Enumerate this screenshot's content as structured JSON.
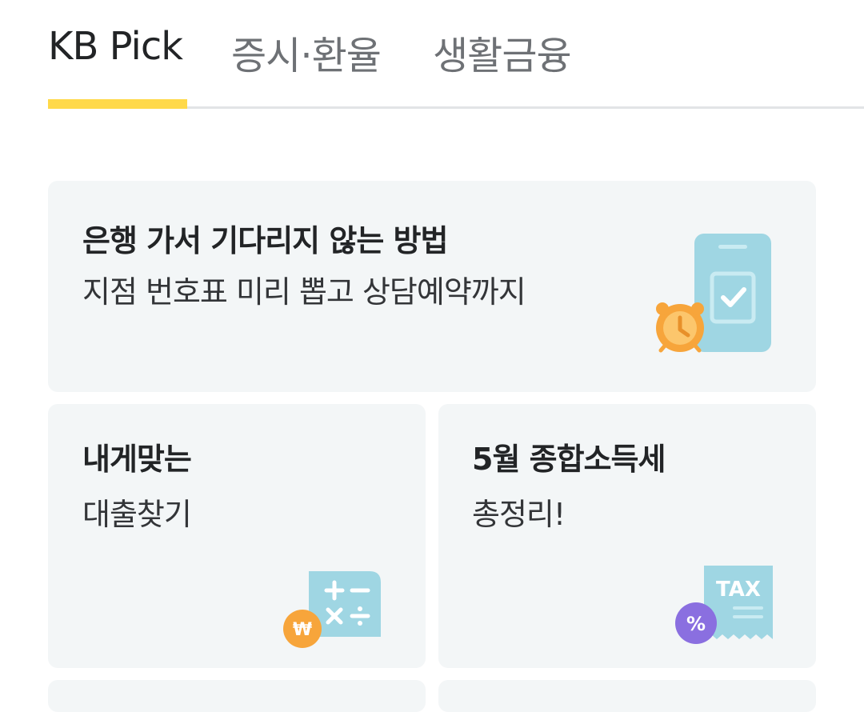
{
  "tabs": [
    {
      "label": "KB Pick",
      "active": true
    },
    {
      "label": "증시·환율",
      "active": false
    },
    {
      "label": "생활금융",
      "active": false
    }
  ],
  "cards": {
    "hero": {
      "title": "은행 가서 기다리지 않는 방법",
      "subtitle": "지점 번호표 미리 뽑고 상담예약까지",
      "icon": "phone-alarm-clock-icon"
    },
    "loan": {
      "title": "내게맞는",
      "subtitle": "대출찾기",
      "icon": "calculator-won-icon"
    },
    "tax": {
      "title": "5월 종합소득세",
      "subtitle": "총정리!",
      "icon": "tax-receipt-percent-icon",
      "icon_text": "TAX",
      "badge_text": "%"
    }
  },
  "colors": {
    "accent": "#ffd94a",
    "card_bg": "#f3f6f7",
    "illus_teal": "#9fd6e3",
    "illus_orange": "#f7a53b",
    "illus_purple": "#8a6fe0"
  }
}
